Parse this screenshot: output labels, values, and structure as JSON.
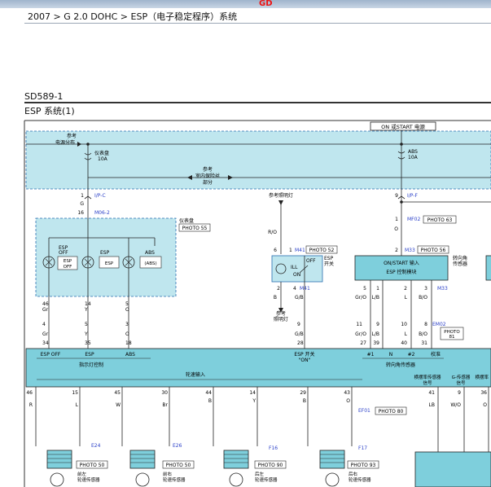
{
  "header": {
    "logo_main": "GD",
    "logo_accent": "D",
    "breadcrumb": "2007 > G 2.0 DOHC > ESP（电子稳定程序）系统"
  },
  "section": {
    "code": "SD589-1",
    "title": "ESP 系统(1)"
  },
  "diagram": {
    "top_label": "ON 或START 电源",
    "ref_power": [
      "参考",
      "电源分布"
    ],
    "fuse_cluster": [
      "仪表盘",
      "10A"
    ],
    "fuse_abs": [
      "ABS",
      "10A"
    ],
    "ref_interior": [
      "参考",
      "室内保险丝",
      "部分"
    ],
    "conn_ipc": "I/P-C",
    "conn_ipf": "I/P-F",
    "conn_m062": "M06-2",
    "pin_1": "1",
    "pin_g": "G",
    "pin_16": "16",
    "pin_9": "9",
    "ref_lighting": "参考照明灯",
    "cluster_title": "仪表盘",
    "photo_55": "PHOTO 55",
    "esp_off_label": [
      "ESP",
      "OFF"
    ],
    "esp_off_box": [
      "ESP",
      "OFF"
    ],
    "esp_label": "ESP",
    "esp_box": "ESP",
    "abs_label": "ABS",
    "abs_box": "(ABS)",
    "mf02": "MF02",
    "photo_63": "PHOTO 63",
    "m41": "M41",
    "photo_52": "PHOTO 52",
    "esp_switch": [
      "ESP",
      "开关"
    ],
    "ill": "ILL",
    "off": "OFF",
    "on": "ON",
    "m33": "M33",
    "photo_56": "PHOTO 56",
    "on_start_input": "ON/START 输入",
    "esp_module": "ESP 控制模块",
    "steer_sensor": [
      "转向角",
      "传感器"
    ],
    "ro": "R/O",
    "gb": "G/B",
    "ref_lamp": [
      "参考",
      "照明灯"
    ],
    "grO": "Gr/O",
    "lb": "L/B",
    "l": "L",
    "bo": "B/O",
    "gr": "Gr",
    "y": "Y",
    "o": "O",
    "m33b": "M33",
    "em02": "EM02",
    "photo_81": "PHOTO 81",
    "bus_labels": {
      "esp_off": "ESP OFF",
      "esp": "ESP",
      "abs": "ABS",
      "esp_switch": "ESP 开关",
      "esp_on": "\"ON\"",
      "n1": "#1",
      "n": "N",
      "n2": "#2",
      "calib": "校准"
    },
    "indicator_ctrl": "指示灯控制",
    "wheel_input": "轮速输入",
    "steer_sensor_bus": "转向角传感器",
    "lat_accel": [
      "横摆率传感器",
      "信号"
    ],
    "g_sensor": [
      "G-传感器",
      "信号"
    ],
    "lat_rate": "横摆率",
    "wheel_pins_top": [
      "46",
      "15",
      "45",
      "30",
      "44",
      "14",
      "29",
      "43"
    ],
    "wheel_wires": [
      "R",
      "L",
      "W",
      "Br",
      "B",
      "Y",
      "B",
      "O"
    ],
    "e24": "E24",
    "e26": "E26",
    "f16": "F16",
    "f17": "F17",
    "ef01": "EF01",
    "photo_80": "PHOTO 80",
    "photo_50a": "PHOTO 50",
    "photo_50b": "PHOTO 50",
    "photo_90": "PHOTO 90",
    "photo_93": "PHOTO 93",
    "sensors": [
      [
        "前左",
        "轮速传感器"
      ],
      [
        "前右",
        "轮速传感器"
      ],
      [
        "后左",
        "轮速传感器"
      ],
      [
        "后右",
        "轮速传感器"
      ]
    ],
    "right_pins": [
      "41",
      "9",
      "36",
      "LB",
      "W/O",
      "O"
    ],
    "colors": {
      "module_fill": "#7ecfdc",
      "dashed_fill": "#bfe6ee",
      "link_blue": "#2a3fc8",
      "wire": "#222222"
    }
  }
}
